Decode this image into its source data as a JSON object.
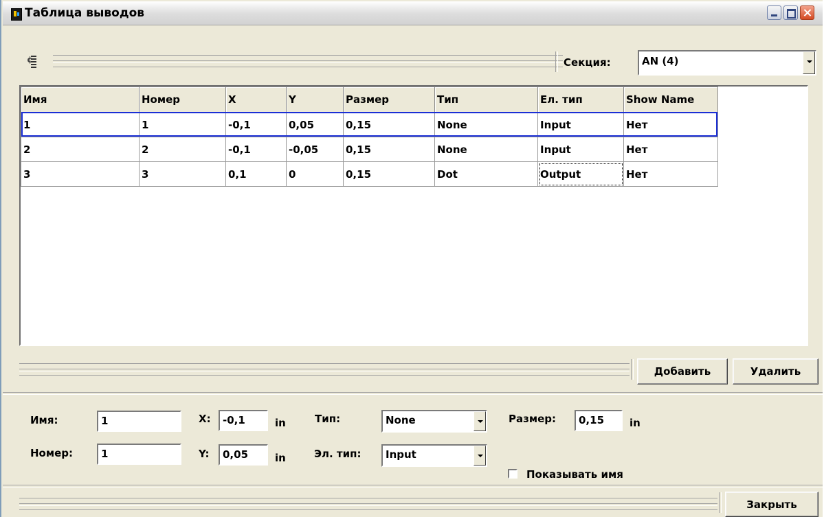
{
  "window": {
    "title": "Таблица выводов",
    "controls": [
      "minimize",
      "maximize",
      "close"
    ]
  },
  "toolbar": {
    "section_label": "Секция:",
    "section_value": "AN (4)"
  },
  "table": {
    "columns": [
      "Имя",
      "Номер",
      "X",
      "Y",
      "Размер",
      "Тип",
      "Ел. тип",
      "Show Name"
    ],
    "rows": [
      [
        "1",
        "1",
        "-0,1",
        "0,05",
        "0,15",
        "None",
        "Input",
        "Нет"
      ],
      [
        "2",
        "2",
        "-0,1",
        "-0,05",
        "0,15",
        "None",
        "Input",
        "Нет"
      ],
      [
        "3",
        "3",
        "0,1",
        "0",
        "0,15",
        "Dot",
        "Output",
        "Нет"
      ]
    ],
    "selected_row": 1
  },
  "actions": {
    "add_label": "Добавить",
    "delete_label": "Удалить",
    "close_label": "Закрыть"
  },
  "form": {
    "name_label": "Имя:",
    "name_value": "1",
    "number_label": "Номер:",
    "number_value": "1",
    "x_label": "X:",
    "x_value": "-0,1",
    "y_label": "Y:",
    "y_value": "0,05",
    "unit": "in",
    "type_label": "Тип:",
    "type_value": "None",
    "eltype_label": "Эл. тип:",
    "eltype_value": "Input",
    "size_label": "Размер:",
    "size_value": "0,15",
    "show_name_label": "Показывать имя",
    "show_name_checked": false
  },
  "colors": {
    "face": "#ece9d8",
    "selection": "#1b2fd6"
  },
  "icons": [
    "app-icon",
    "table-settings-icon",
    "minimize-icon",
    "maximize-icon",
    "close-icon",
    "chevron-down-icon"
  ]
}
